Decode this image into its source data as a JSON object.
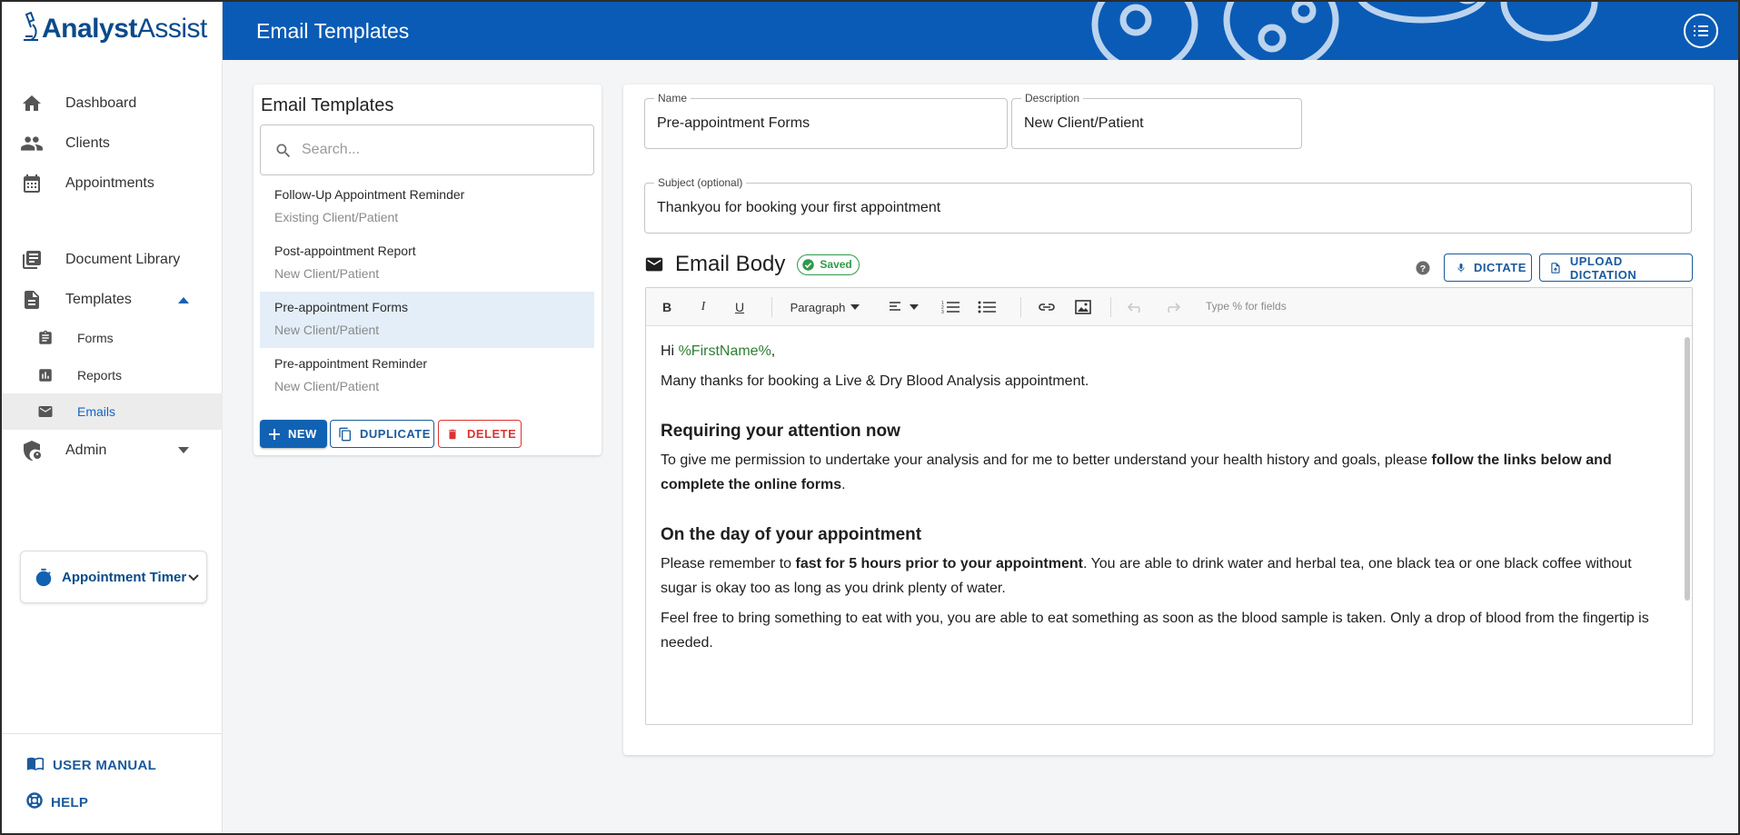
{
  "app": {
    "logo_part1": "Analyst",
    "logo_part2": "Assist",
    "header_title": "Email Templates",
    "brand_color": "#0a5bb5"
  },
  "sidebar": {
    "items": [
      {
        "label": "Dashboard",
        "icon": "home-icon"
      },
      {
        "label": "Clients",
        "icon": "people-icon"
      },
      {
        "label": "Appointments",
        "icon": "calendar-icon"
      },
      {
        "label": "Document Library",
        "icon": "library-icon"
      },
      {
        "label": "Templates",
        "icon": "document-icon",
        "expanded": true
      },
      {
        "label": "Forms",
        "icon": "clipboard-icon"
      },
      {
        "label": "Reports",
        "icon": "chart-icon"
      },
      {
        "label": "Emails",
        "icon": "mail-icon",
        "active": true
      },
      {
        "label": "Admin",
        "icon": "admin-shield-icon",
        "expanded": false
      }
    ],
    "timer_label": "Appointment Timer",
    "user_manual": "USER MANUAL",
    "help": "HELP"
  },
  "templates_panel": {
    "title": "Email Templates",
    "search_placeholder": "Search...",
    "items": [
      {
        "name": "Follow-Up Appointment Reminder",
        "desc": "Existing Client/Patient"
      },
      {
        "name": "Post-appointment Report",
        "desc": "New Client/Patient"
      },
      {
        "name": "Pre-appointment Forms",
        "desc": "New Client/Patient",
        "selected": true
      },
      {
        "name": "Pre-appointment Reminder",
        "desc": "New Client/Patient"
      }
    ],
    "new_label": "NEW",
    "duplicate_label": "DUPLICATE",
    "delete_label": "DELETE"
  },
  "editor": {
    "name_label": "Name",
    "name_value": "Pre-appointment Forms",
    "desc_label": "Description",
    "desc_value": "New Client/Patient",
    "subject_label": "Subject (optional)",
    "subject_value": "Thankyou for booking your first appointment",
    "body_title": "Email Body",
    "saved_label": "Saved",
    "dictate_label": "DICTATE",
    "upload_label": "UPLOAD DICTATION",
    "toolbar": {
      "bold": "B",
      "italic": "I",
      "underline": "U",
      "paragraph": "Paragraph",
      "hint": "Type % for fields"
    },
    "content": {
      "greeting_prefix": "Hi ",
      "merge_field": "%FirstName%",
      "greeting_suffix": ",",
      "p1": "Many thanks for booking a Live & Dry Blood Analysis appointment.",
      "h1": "Requiring your attention now",
      "p2_pre": "To give me permission to undertake your analysis and for me to better understand your health history and goals, please ",
      "p2_bold": "follow the links below and complete the online forms",
      "p2_post": ".",
      "h2": "On the day of your appointment",
      "p3_pre": "Please remember to ",
      "p3_bold": "fast for 5 hours prior to your appointment",
      "p3_post": ". You are able to drink water and herbal tea, one black tea or one black coffee without sugar is okay too as long as you drink plenty of water.",
      "p4": "Feel free to bring something to eat with you, you are able to eat something as soon as the blood sample is taken. Only a drop of blood from the fingertip is needed."
    }
  }
}
